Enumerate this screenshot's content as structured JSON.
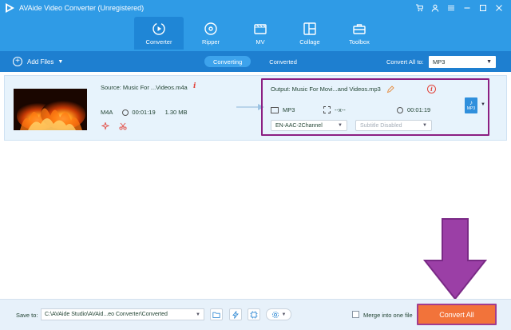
{
  "window": {
    "title": "AVAide Video Converter (Unregistered)",
    "controls": [
      "cart-icon",
      "account-icon",
      "menu-icon",
      "minimize-icon",
      "maximize-icon",
      "close-icon"
    ]
  },
  "nav": {
    "items": [
      {
        "label": "Converter",
        "icon": "converter-icon",
        "active": true
      },
      {
        "label": "Ripper",
        "icon": "ripper-icon",
        "active": false
      },
      {
        "label": "MV",
        "icon": "mv-icon",
        "active": false
      },
      {
        "label": "Collage",
        "icon": "collage-icon",
        "active": false
      },
      {
        "label": "Toolbox",
        "icon": "toolbox-icon",
        "active": false
      }
    ]
  },
  "toolbar": {
    "add_files_label": "Add Files",
    "tab_converting": "Converting",
    "tab_converted": "Converted",
    "convert_all_to_label": "Convert All to:",
    "convert_all_format": "MP3"
  },
  "file": {
    "source_name": "Source: Music For ...Videos.m4a",
    "format": "M4A",
    "duration": "00:01:19",
    "size": "1.30 MB",
    "output_name": "Output: Music For Movi...and Videos.mp3",
    "output_format": "MP3",
    "output_resolution": "--x--",
    "output_duration": "00:01:19",
    "audio_track": "EN-AAC-2Channel",
    "subtitle": "Subtitle Disabled",
    "format_badge": "MP3"
  },
  "bottom": {
    "save_to_label": "Save to:",
    "save_path": "C:\\AVAide Studio\\AVAid...eo Converter\\Converted",
    "merge_label": "Merge into one file",
    "merge_checked": false,
    "convert_all_label": "Convert All"
  },
  "colors": {
    "header": "#2f9be6",
    "toolbar": "#1e7fd0",
    "accent_orange": "#f2733a",
    "annotation_purple": "#9b3fa6"
  }
}
